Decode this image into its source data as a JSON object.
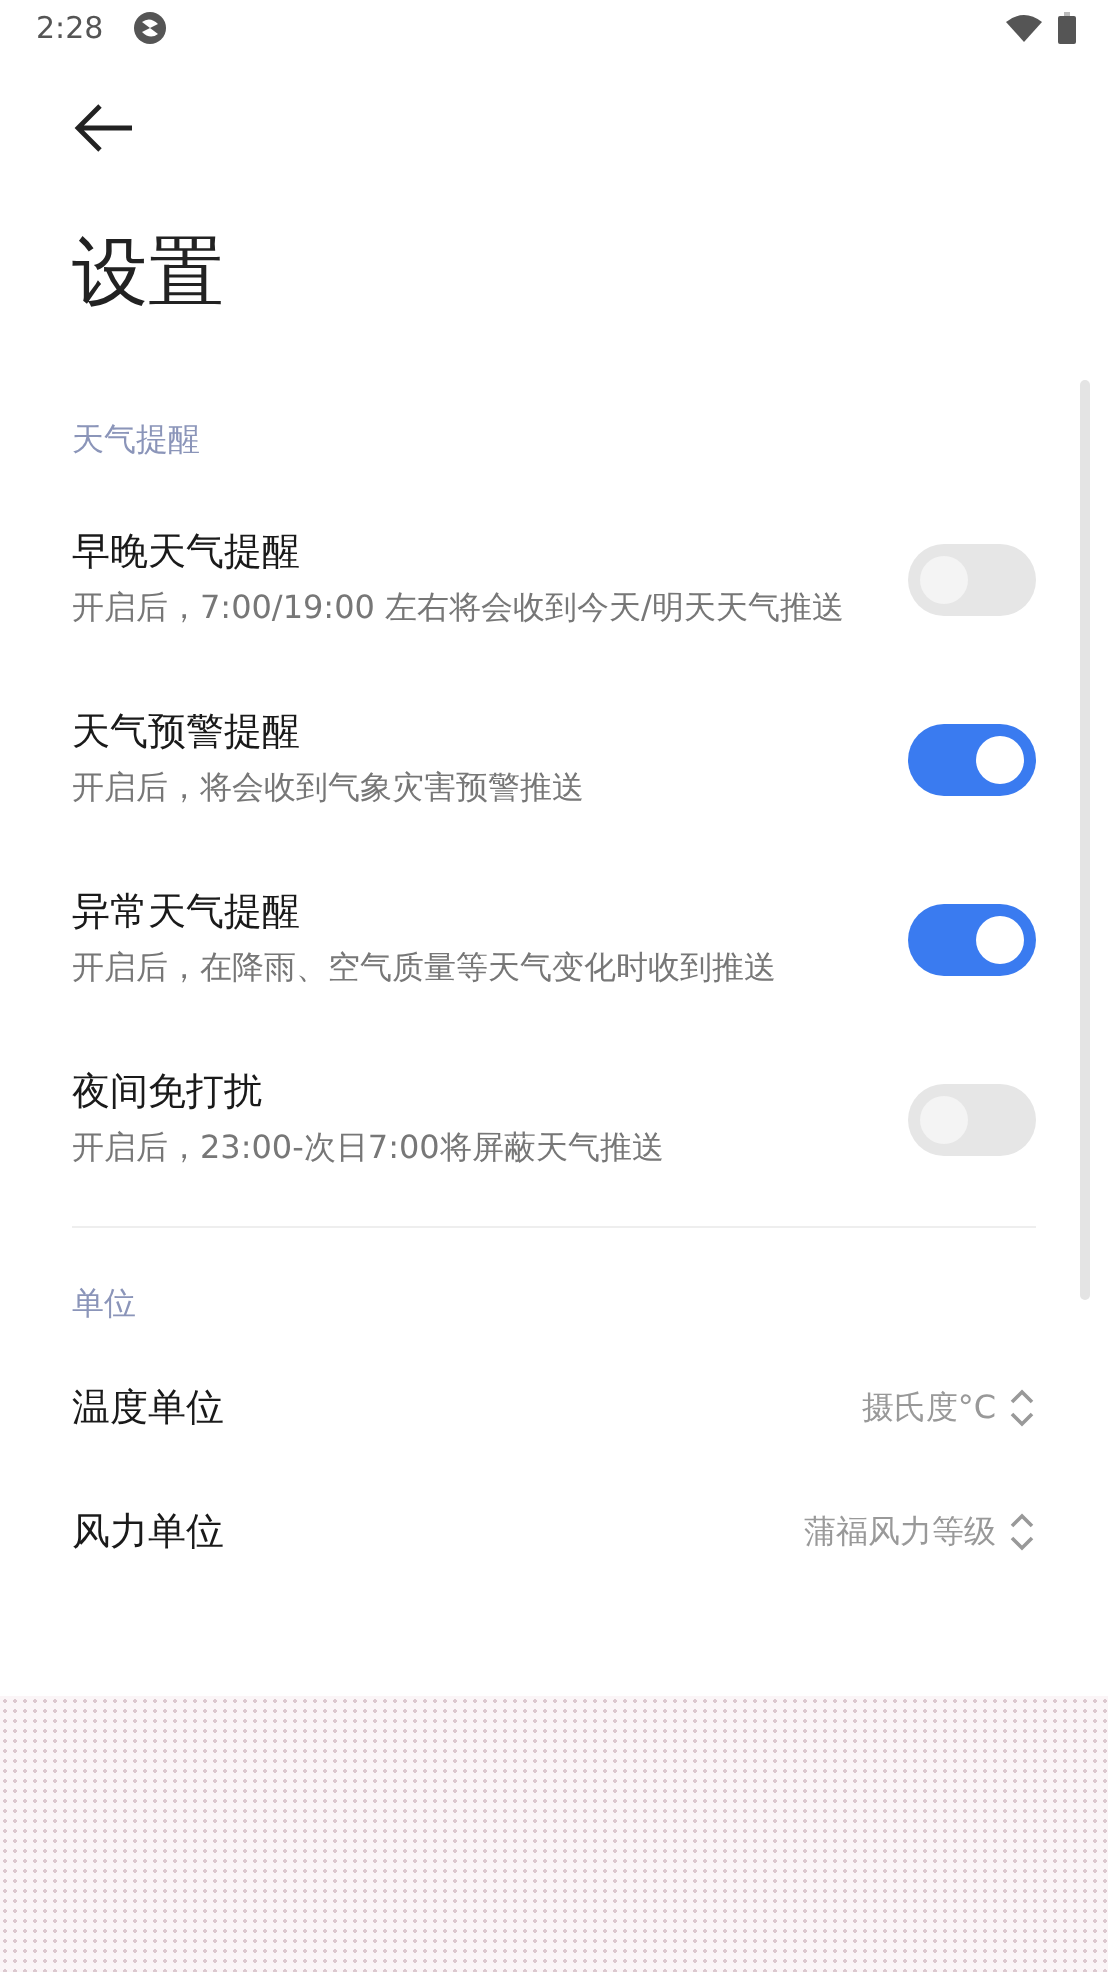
{
  "status_bar": {
    "time": "2:28"
  },
  "title": "设置",
  "sections": [
    {
      "title": "天气提醒",
      "items": [
        {
          "kind": "toggle",
          "title": "早晚天气提醒",
          "subtitle": "开启后，7:00/19:00 左右将会收到今天/明天天气推送",
          "on": false
        },
        {
          "kind": "toggle",
          "title": "天气预警提醒",
          "subtitle": "开启后，将会收到气象灾害预警推送",
          "on": true
        },
        {
          "kind": "toggle",
          "title": "异常天气提醒",
          "subtitle": "开启后，在降雨、空气质量等天气变化时收到推送",
          "on": true
        },
        {
          "kind": "toggle",
          "title": "夜间免打扰",
          "subtitle": "开启后，23:00-次日7:00将屏蔽天气推送",
          "on": false
        }
      ]
    },
    {
      "title": "单位",
      "items": [
        {
          "kind": "select",
          "title": "温度单位",
          "value": "摄氏度°C"
        },
        {
          "kind": "select",
          "title": "风力单位",
          "value": "蒲福风力等级"
        }
      ]
    }
  ]
}
